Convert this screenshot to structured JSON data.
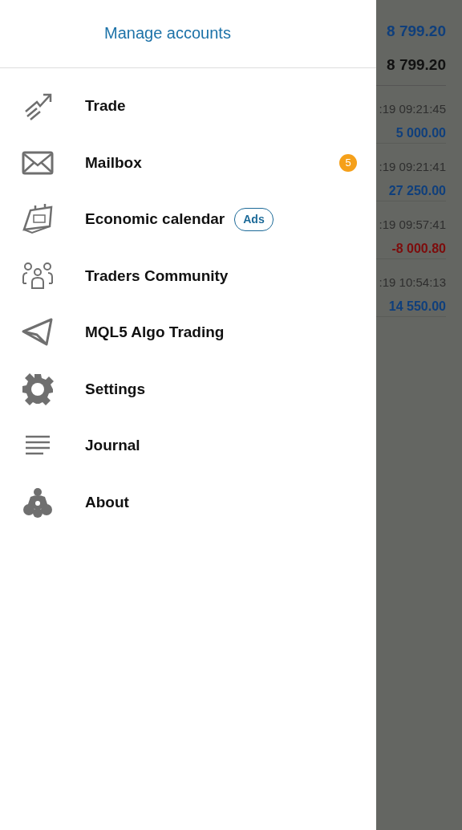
{
  "background": {
    "balances": [
      "8 799.20",
      "8 799.20"
    ],
    "history": [
      {
        "time": ":19 09:21:45",
        "amount": "5 000.00",
        "color": "#0f3f7c"
      },
      {
        "time": ":19 09:21:41",
        "amount": "27 250.00",
        "color": "#0f3f7c"
      },
      {
        "time": ":19 09:57:41",
        "amount": "-8 000.80",
        "color": "#7d0c0c"
      },
      {
        "time": ":19 10:54:13",
        "amount": "14 550.00",
        "color": "#0f3f7c"
      }
    ]
  },
  "drawer": {
    "manage_accounts": "Manage accounts",
    "items": [
      {
        "label": "Trade"
      },
      {
        "label": "Mailbox",
        "badge": "5"
      },
      {
        "label": "Economic calendar",
        "tag": "Ads"
      },
      {
        "label": "Traders Community"
      },
      {
        "label": "MQL5 Algo Trading"
      },
      {
        "label": "Settings"
      },
      {
        "label": "Journal"
      },
      {
        "label": "About"
      }
    ]
  }
}
